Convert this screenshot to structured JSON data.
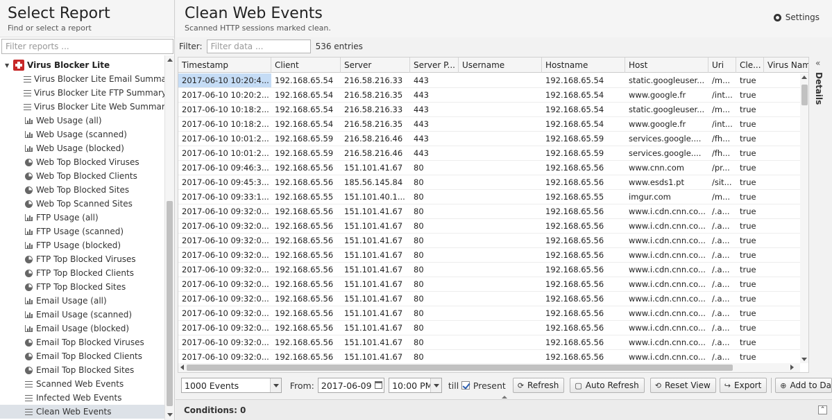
{
  "left": {
    "title": "Select Report",
    "subtitle": "Find or select a report",
    "filter_placeholder": "Filter reports ...",
    "app_name": "Virus Blocker Lite",
    "items": [
      {
        "label": "Virus Blocker Lite Email Summary",
        "icon": "text"
      },
      {
        "label": "Virus Blocker Lite FTP Summary",
        "icon": "text"
      },
      {
        "label": "Virus Blocker Lite Web Summary",
        "icon": "text"
      },
      {
        "label": "Web Usage (all)",
        "icon": "bar"
      },
      {
        "label": "Web Usage (scanned)",
        "icon": "bar"
      },
      {
        "label": "Web Usage (blocked)",
        "icon": "bar"
      },
      {
        "label": "Web Top Blocked Viruses",
        "icon": "pie"
      },
      {
        "label": "Web Top Blocked Clients",
        "icon": "pie"
      },
      {
        "label": "Web Top Blocked Sites",
        "icon": "pie"
      },
      {
        "label": "Web Top Scanned Sites",
        "icon": "pie"
      },
      {
        "label": "FTP Usage (all)",
        "icon": "bar"
      },
      {
        "label": "FTP Usage (scanned)",
        "icon": "bar"
      },
      {
        "label": "FTP Usage (blocked)",
        "icon": "bar"
      },
      {
        "label": "FTP Top Blocked Viruses",
        "icon": "pie"
      },
      {
        "label": "FTP Top Blocked Clients",
        "icon": "pie"
      },
      {
        "label": "FTP Top Blocked Sites",
        "icon": "pie"
      },
      {
        "label": "Email Usage (all)",
        "icon": "bar"
      },
      {
        "label": "Email Usage (scanned)",
        "icon": "bar"
      },
      {
        "label": "Email Usage (blocked)",
        "icon": "bar"
      },
      {
        "label": "Email Top Blocked Viruses",
        "icon": "pie"
      },
      {
        "label": "Email Top Blocked Clients",
        "icon": "pie"
      },
      {
        "label": "Email Top Blocked Sites",
        "icon": "pie"
      },
      {
        "label": "Scanned Web Events",
        "icon": "list"
      },
      {
        "label": "Infected Web Events",
        "icon": "list"
      },
      {
        "label": "Clean Web Events",
        "icon": "list",
        "selected": true
      }
    ]
  },
  "main": {
    "title": "Clean Web Events",
    "subtitle": "Scanned HTTP sessions marked clean.",
    "settings_label": "Settings",
    "filter_label": "Filter:",
    "filter_placeholder": "Filter data ...",
    "entries": "536 entries",
    "details_label": "Details"
  },
  "grid": {
    "columns": [
      "Timestamp",
      "Client",
      "Server",
      "Server P...",
      "Username",
      "Hostname",
      "Host",
      "Uri",
      "Cle...",
      "Virus Nam"
    ],
    "rows": [
      [
        "2017-06-10 10:20:4...",
        "192.168.65.54",
        "216.58.216.33",
        "443",
        "",
        "192.168.65.54",
        "static.googleuser...",
        "/m...",
        "true",
        ""
      ],
      [
        "2017-06-10 10:20:2...",
        "192.168.65.54",
        "216.58.216.35",
        "443",
        "",
        "192.168.65.54",
        "www.google.fr",
        "/int...",
        "true",
        ""
      ],
      [
        "2017-06-10 10:18:2...",
        "192.168.65.54",
        "216.58.216.33",
        "443",
        "",
        "192.168.65.54",
        "static.googleuser...",
        "/m...",
        "true",
        ""
      ],
      [
        "2017-06-10 10:18:2...",
        "192.168.65.54",
        "216.58.216.35",
        "443",
        "",
        "192.168.65.54",
        "www.google.fr",
        "/int...",
        "true",
        ""
      ],
      [
        "2017-06-10 10:01:2...",
        "192.168.65.59",
        "216.58.216.46",
        "443",
        "",
        "192.168.65.59",
        "services.google....",
        "/fh...",
        "true",
        ""
      ],
      [
        "2017-06-10 10:01:2...",
        "192.168.65.59",
        "216.58.216.46",
        "443",
        "",
        "192.168.65.59",
        "services.google....",
        "/fh...",
        "true",
        ""
      ],
      [
        "2017-06-10 09:46:3...",
        "192.168.65.56",
        "151.101.41.67",
        "80",
        "",
        "192.168.65.56",
        "www.cnn.com",
        "/pr...",
        "true",
        ""
      ],
      [
        "2017-06-10 09:45:3...",
        "192.168.65.56",
        "185.56.145.84",
        "80",
        "",
        "192.168.65.56",
        "www.esds1.pt",
        "/sit...",
        "true",
        ""
      ],
      [
        "2017-06-10 09:33:1...",
        "192.168.65.55",
        "151.101.40.1...",
        "80",
        "",
        "192.168.65.55",
        "imgur.com",
        "/m...",
        "true",
        ""
      ],
      [
        "2017-06-10 09:32:0...",
        "192.168.65.56",
        "151.101.41.67",
        "80",
        "",
        "192.168.65.56",
        "www.i.cdn.cnn.co...",
        "/.a...",
        "true",
        ""
      ],
      [
        "2017-06-10 09:32:0...",
        "192.168.65.56",
        "151.101.41.67",
        "80",
        "",
        "192.168.65.56",
        "www.i.cdn.cnn.co...",
        "/.a...",
        "true",
        ""
      ],
      [
        "2017-06-10 09:32:0...",
        "192.168.65.56",
        "151.101.41.67",
        "80",
        "",
        "192.168.65.56",
        "www.i.cdn.cnn.co...",
        "/.a...",
        "true",
        ""
      ],
      [
        "2017-06-10 09:32:0...",
        "192.168.65.56",
        "151.101.41.67",
        "80",
        "",
        "192.168.65.56",
        "www.i.cdn.cnn.co...",
        "/.a...",
        "true",
        ""
      ],
      [
        "2017-06-10 09:32:0...",
        "192.168.65.56",
        "151.101.41.67",
        "80",
        "",
        "192.168.65.56",
        "www.i.cdn.cnn.co...",
        "/.a...",
        "true",
        ""
      ],
      [
        "2017-06-10 09:32:0...",
        "192.168.65.56",
        "151.101.41.67",
        "80",
        "",
        "192.168.65.56",
        "www.i.cdn.cnn.co...",
        "/.a...",
        "true",
        ""
      ],
      [
        "2017-06-10 09:32:0...",
        "192.168.65.56",
        "151.101.41.67",
        "80",
        "",
        "192.168.65.56",
        "www.i.cdn.cnn.co...",
        "/.a...",
        "true",
        ""
      ],
      [
        "2017-06-10 09:32:0...",
        "192.168.65.56",
        "151.101.41.67",
        "80",
        "",
        "192.168.65.56",
        "www.i.cdn.cnn.co...",
        "/.a...",
        "true",
        ""
      ],
      [
        "2017-06-10 09:32:0...",
        "192.168.65.56",
        "151.101.41.67",
        "80",
        "",
        "192.168.65.56",
        "www.i.cdn.cnn.co...",
        "/.a...",
        "true",
        ""
      ],
      [
        "2017-06-10 09:32:0...",
        "192.168.65.56",
        "151.101.41.67",
        "80",
        "",
        "192.168.65.56",
        "www.i.cdn.cnn.co...",
        "/.a...",
        "true",
        ""
      ],
      [
        "2017-06-10 09:32:0...",
        "192.168.65.56",
        "151.101.41.67",
        "80",
        "",
        "192.168.65.56",
        "www.i.cdn.cnn.co...",
        "/.a...",
        "true",
        ""
      ]
    ]
  },
  "toolbar": {
    "events_select": "1000 Events",
    "from_label": "From:",
    "from_date": "2017-06-09",
    "from_time": "10:00 PM",
    "till_label": "till",
    "present_label": "Present",
    "present_checked": true,
    "refresh": "Refresh",
    "auto_refresh": "Auto Refresh",
    "reset_view": "Reset View",
    "export": "Export",
    "add_to_dashboard": "Add to Da"
  },
  "conditions": {
    "label": "Conditions: 0"
  }
}
